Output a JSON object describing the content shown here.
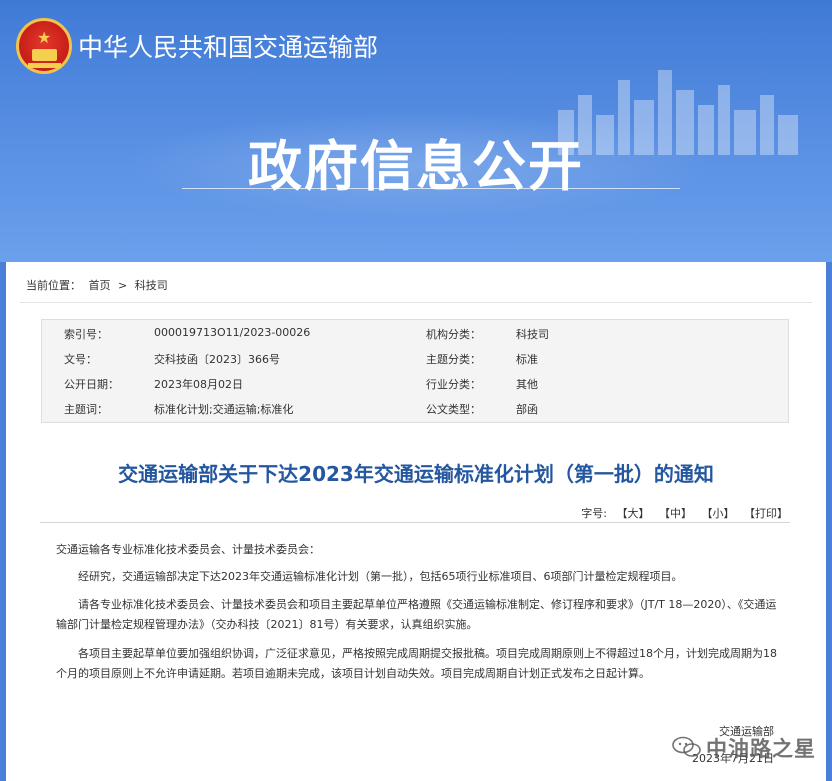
{
  "header": {
    "ministry_title": "中华人民共和国交通运输部",
    "section_title": "政府信息公开",
    "colors": {
      "banner": "#4a7fd8",
      "title_text": "#24579f"
    }
  },
  "breadcrumb": {
    "label": "当前位置：",
    "items": [
      "首页",
      ">",
      "科技司"
    ]
  },
  "meta": {
    "rows": [
      {
        "k1": "索引号：",
        "v1": "000019713O11/2023-00026",
        "k2": "机构分类：",
        "v2": "科技司"
      },
      {
        "k1": "文号：",
        "v1": "交科技函〔2023〕366号",
        "k2": "主题分类：",
        "v2": "标准"
      },
      {
        "k1": "公开日期：",
        "v1": "2023年08月02日",
        "k2": "行业分类：",
        "v2": "其他"
      },
      {
        "k1": "主题词：",
        "v1": "标准化计划;交通运输;标准化",
        "k2": "公文类型：",
        "v2": "部函"
      }
    ]
  },
  "document": {
    "title": "交通运输部关于下达2023年交通运输标准化计划（第一批）的通知",
    "tools": {
      "font_label": "字号:",
      "large": "【大】",
      "medium": "【中】",
      "small": "【小】",
      "print": "【打印】"
    },
    "salutation": "交通运输各专业标准化技术委员会、计量技术委员会：",
    "para1": "经研究，交通运输部决定下达2023年交通运输标准化计划（第一批），包括65项行业标准项目、6项部门计量检定规程项目。",
    "para2": "请各专业标准化技术委员会、计量技术委员会和项目主要起草单位严格遵照《交通运输标准制定、修订程序和要求》（JT/T 18—2020）、《交通运输部门计量检定规程管理办法》（交办科技〔2021〕81号）有关要求，认真组织实施。",
    "para3": "各项目主要起草单位要加强组织协调，广泛征求意见，严格按照完成周期提交报批稿。项目完成周期原则上不得超过18个月，计划完成周期为18个月的项目原则上不允许申请延期。若项目逾期未完成，该项目计划自动失效。项目完成周期自计划正式发布之日起计算。",
    "signature": "交通运输部",
    "date": "2023年7月21日"
  },
  "watermark": {
    "text": "中油路之星",
    "icon": "wechat-icon"
  }
}
